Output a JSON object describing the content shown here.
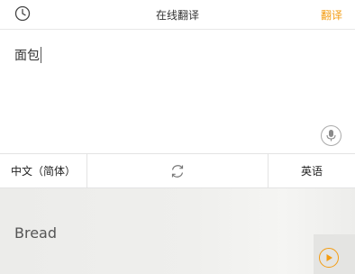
{
  "header": {
    "title": "在线翻译",
    "translate_label": "翻译",
    "history_icon": "clock-icon"
  },
  "input": {
    "value": "面包",
    "mic_icon": "microphone-icon"
  },
  "languages": {
    "source": "中文（简体）",
    "target": "英语",
    "swap_icon": "swap-arrows-icon"
  },
  "result": {
    "text": "Bread",
    "play_icon": "play-icon"
  },
  "colors": {
    "accent": "#f39c12"
  }
}
